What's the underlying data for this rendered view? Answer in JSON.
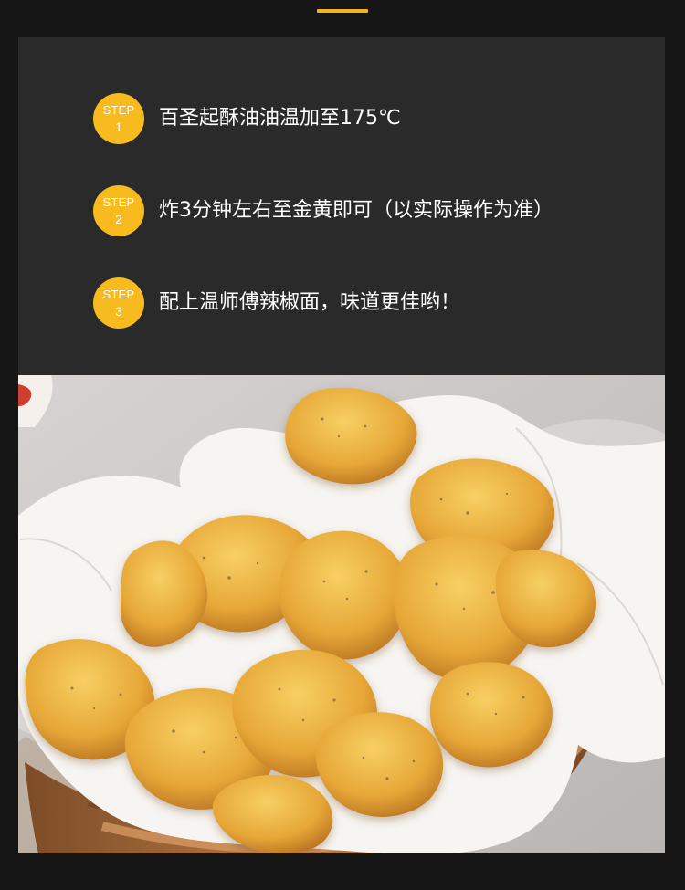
{
  "steps": [
    {
      "badge_label": "STEP",
      "badge_number": "1",
      "text": "百圣起酥油油温加至175℃"
    },
    {
      "badge_label": "STEP",
      "badge_number": "2",
      "text": "炸3分钟左右至金黄即可（以实际操作为准）"
    },
    {
      "badge_label": "STEP",
      "badge_number": "3",
      "text": "配上温师傅辣椒面，味道更佳哟！"
    }
  ],
  "colors": {
    "background": "#161616",
    "panel": "#2a2a2a",
    "accent": "#f7bb1f",
    "text": "#ffffff"
  },
  "photo": {
    "subject": "fried chicken nuggets with pepper in a paper-lined wooden basket",
    "icon": "food-photo"
  }
}
